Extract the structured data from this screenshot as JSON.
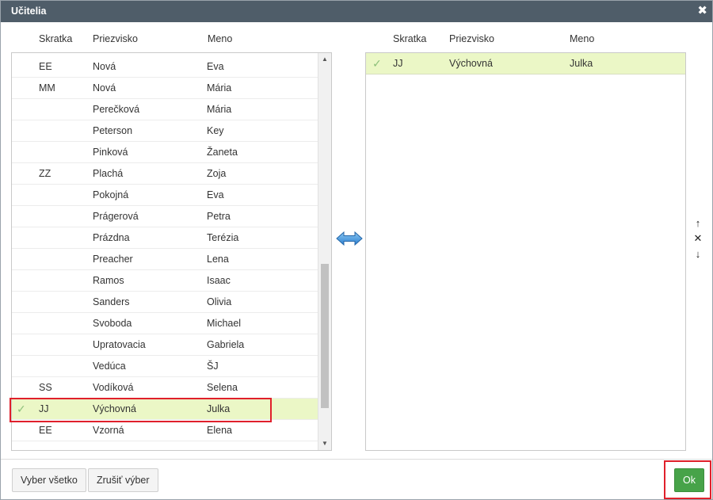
{
  "dialog": {
    "title": "Učitelia",
    "close_icon": "close-icon"
  },
  "columns": {
    "abbr": "Skratka",
    "last_name": "Priezvisko",
    "first_name": "Meno"
  },
  "available_list": {
    "rows": [
      {
        "checked": false,
        "abbr": "EE",
        "last": "Nová",
        "first": "Eva"
      },
      {
        "checked": false,
        "abbr": "MM",
        "last": "Nová",
        "first": "Mária"
      },
      {
        "checked": false,
        "abbr": "",
        "last": "Perečková",
        "first": "Mária"
      },
      {
        "checked": false,
        "abbr": "",
        "last": "Peterson",
        "first": "Key"
      },
      {
        "checked": false,
        "abbr": "",
        "last": "Pinková",
        "first": "Žaneta"
      },
      {
        "checked": false,
        "abbr": "ZZ",
        "last": "Plachá",
        "first": "Zoja"
      },
      {
        "checked": false,
        "abbr": "",
        "last": "Pokojná",
        "first": "Eva"
      },
      {
        "checked": false,
        "abbr": "",
        "last": "Prágerová",
        "first": "Petra"
      },
      {
        "checked": false,
        "abbr": "",
        "last": "Prázdna",
        "first": "Terézia"
      },
      {
        "checked": false,
        "abbr": "",
        "last": "Preacher",
        "first": "Lena"
      },
      {
        "checked": false,
        "abbr": "",
        "last": "Ramos",
        "first": "Isaac"
      },
      {
        "checked": false,
        "abbr": "",
        "last": "Sanders",
        "first": "Olivia"
      },
      {
        "checked": false,
        "abbr": "",
        "last": "Svoboda",
        "first": "Michael"
      },
      {
        "checked": false,
        "abbr": "",
        "last": "Upratovacia",
        "first": "Gabriela"
      },
      {
        "checked": false,
        "abbr": "",
        "last": "Vedúca",
        "first": "ŠJ"
      },
      {
        "checked": false,
        "abbr": "SS",
        "last": "Vodíková",
        "first": "Selena"
      },
      {
        "checked": true,
        "abbr": "JJ",
        "last": "Výchovná",
        "first": "Julka"
      },
      {
        "checked": false,
        "abbr": "EE",
        "last": "Vzorná",
        "first": "Elena"
      }
    ],
    "scroll_position": 0.85
  },
  "selected_list": {
    "rows": [
      {
        "checked": true,
        "abbr": "JJ",
        "last": "Výchovná",
        "first": "Julka"
      }
    ]
  },
  "icons": {
    "check": "✓",
    "transfer": "double-arrow-icon",
    "move_up": "↑",
    "remove": "✕",
    "move_down": "↓"
  },
  "colors": {
    "titlebar": "#4f5d69",
    "selected_row": "#ebf7c6",
    "highlight": "#e0202b",
    "ok_button": "#47a349",
    "check": "#8cc07a",
    "transfer_arrow": "#3a8fd8"
  },
  "footer": {
    "select_all": "Vyber všetko",
    "clear_selection": "Zrušiť výber",
    "ok": "Ok"
  }
}
